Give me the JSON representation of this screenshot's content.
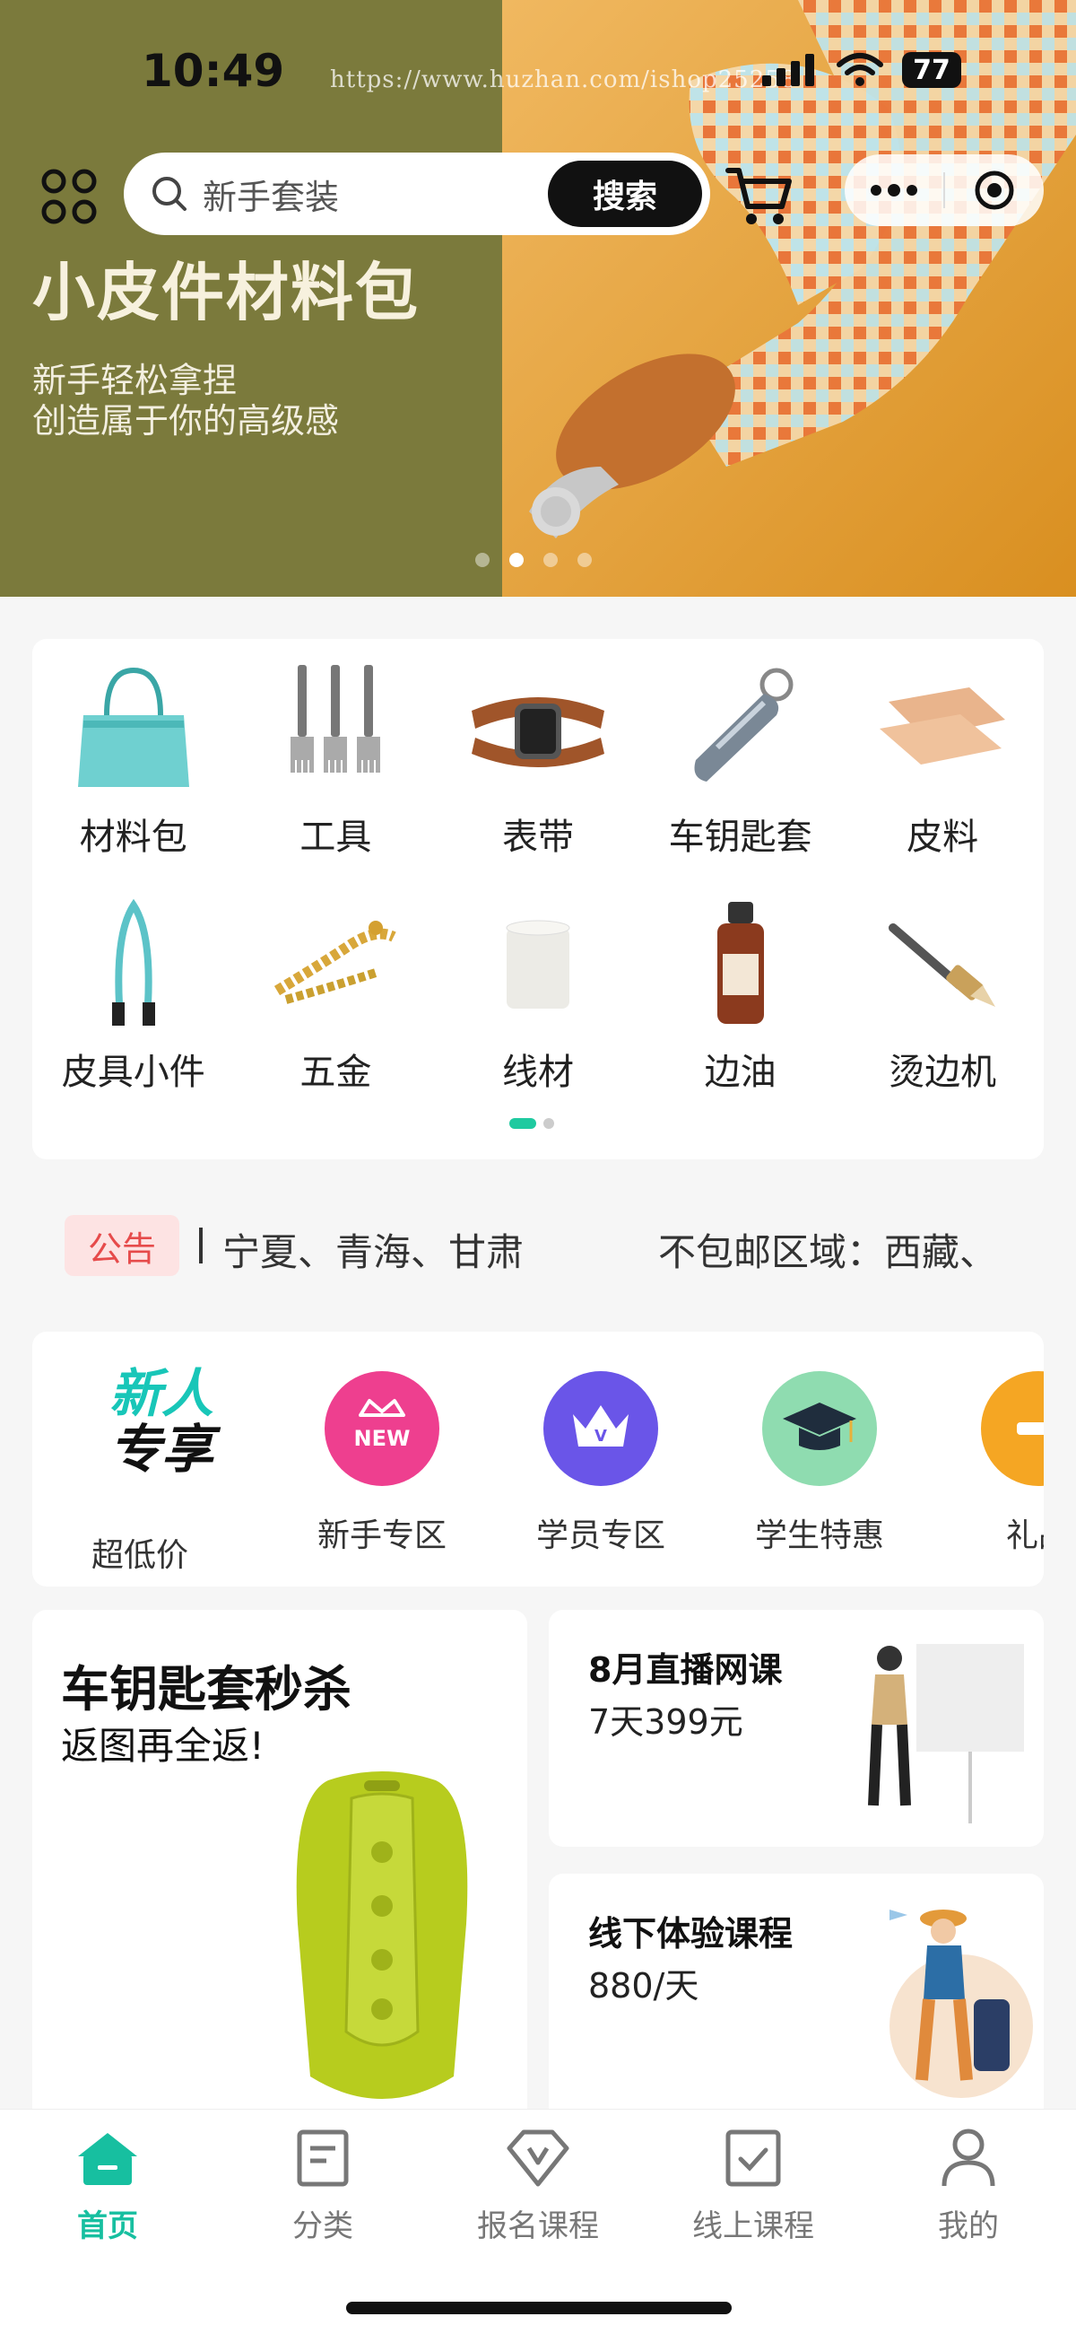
{
  "status": {
    "time": "10:49",
    "battery": "77"
  },
  "watermark": "https://www.huzhan.com/ishop25258",
  "banner": {
    "title": "小皮件材料包",
    "subtitle_1": "新手轻松拿捏",
    "subtitle_2": "创造属于你的高级感",
    "slide_count": 4,
    "active_slide": 2,
    "bg_color": "#7b7a3c"
  },
  "search": {
    "placeholder": "新手套装",
    "button": "搜索"
  },
  "categories": [
    {
      "label": "材料包",
      "icon": "handbag-icon"
    },
    {
      "label": "工具",
      "icon": "forks-tool-icon"
    },
    {
      "label": "表带",
      "icon": "watch-strap-icon"
    },
    {
      "label": "车钥匙套",
      "icon": "car-key-case-icon"
    },
    {
      "label": "皮料",
      "icon": "leather-sheets-icon"
    },
    {
      "label": "皮具小件",
      "icon": "strap-icon"
    },
    {
      "label": "五金",
      "icon": "chain-icon"
    },
    {
      "label": "线材",
      "icon": "thread-spool-icon"
    },
    {
      "label": "边油",
      "icon": "edge-oil-bottle-icon"
    },
    {
      "label": "烫边机",
      "icon": "edge-creaser-icon"
    }
  ],
  "notice": {
    "tag": "公告",
    "text_1": "宁夏、青海、甘肃",
    "text_2": "不包邮区域：西藏、"
  },
  "promo": {
    "badge_line_1": "新人",
    "badge_line_2": "专享",
    "items": [
      "超低价",
      "新手专区",
      "学员专区",
      "学生特惠",
      "礼品"
    ],
    "new_badge": "NEW",
    "v_badge": "V"
  },
  "cards": {
    "big": {
      "title": "车钥匙套秒杀",
      "subtitle": "返图再全返!"
    },
    "live": {
      "title": "8月直播网课",
      "subtitle": "7天399元"
    },
    "offline": {
      "title": "线下体验课程",
      "subtitle": "880/天"
    }
  },
  "tabs": [
    {
      "label": "首页",
      "icon": "home-icon",
      "active": true
    },
    {
      "label": "分类",
      "icon": "category-icon",
      "active": false
    },
    {
      "label": "报名课程",
      "icon": "enroll-course-icon",
      "active": false
    },
    {
      "label": "线上课程",
      "icon": "online-course-icon",
      "active": false
    },
    {
      "label": "我的",
      "icon": "profile-icon",
      "active": false
    }
  ],
  "colors": {
    "accent": "#17bfa0",
    "notice_red": "#e64b4b",
    "promo_pink": "#ee3f8f",
    "promo_purple": "#6a55e8",
    "promo_green": "#8fdcb0",
    "promo_orange": "#f5a623"
  }
}
